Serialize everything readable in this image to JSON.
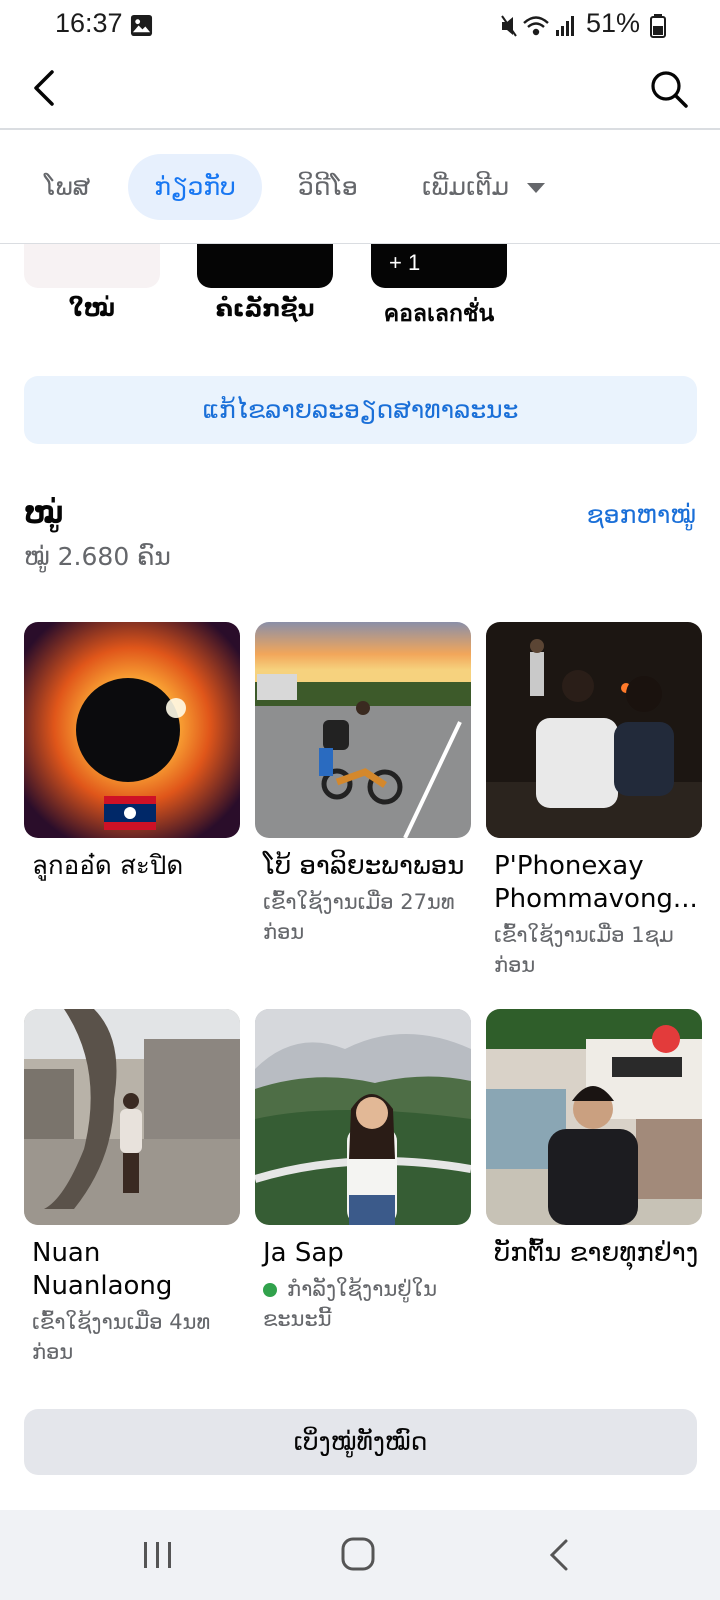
{
  "status_bar": {
    "time": "16:37",
    "battery": "51%"
  },
  "tabs": {
    "posts": "ໂພສ",
    "about": "ກ່ຽວກັບ",
    "video": "ວິດີໂອ",
    "more": "ເພີ່ມເຕີມ"
  },
  "highlights": {
    "items": [
      {
        "label": "ໃໝ່"
      },
      {
        "label": "ຄໍເລັກຊັນ"
      },
      {
        "label": "คอลเลกชั่น",
        "badge": "+ 1"
      }
    ]
  },
  "edit_public_details": "ແກ້ໄຂລາຍລະອຽດສາທາລະນະ",
  "friends": {
    "title": "ໝູ່",
    "count": "ໝູ່ 2.680 ຄົນ",
    "find_link": "ຊອກຫາໝູ່",
    "list": [
      {
        "name": "ลูกออ๋ด สะปิด",
        "sub": ""
      },
      {
        "name": "ໂບ້ ອາລິຍະພາພອນ",
        "sub": "ເຂົ້າໃຊ້ງານເມື່ອ 27ນທ ກ່ອນ"
      },
      {
        "name": "P'Phonexay Phommavong...",
        "sub": "ເຂົ້າໃຊ້ງານເມື່ອ 1ຊມ ກ່ອນ"
      },
      {
        "name": "Nuan Nuanlaong",
        "sub": "ເຂົ້າໃຊ້ງານເມື່ອ 4ນທ ກ່ອນ"
      },
      {
        "name": "Ja Sap",
        "sub": "ກຳລັງໃຊ້ງານຢູ່ໃນ ຂະນະນີ້",
        "online": true
      },
      {
        "name": "ບັກຕົ້ນ ຂາຍທຸກຢ່າງ",
        "sub": ""
      }
    ],
    "see_all": "ເບິ່ງໝູ່ທັງໝົດ"
  },
  "colors": {
    "accent": "#1877f2",
    "online": "#31a24c",
    "muted": "#65676b"
  },
  "icons": [
    "image-icon",
    "mute-icon",
    "wifi-icon",
    "signal-icon",
    "battery-icon",
    "back-arrow-icon",
    "search-icon",
    "caret-down-icon",
    "recent-apps-icon",
    "home-icon",
    "nav-back-icon"
  ]
}
